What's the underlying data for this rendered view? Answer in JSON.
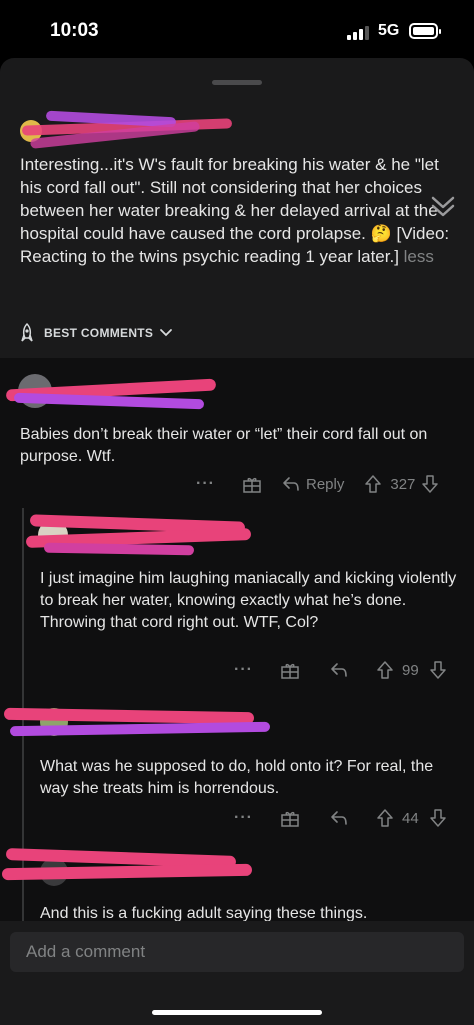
{
  "status_bar": {
    "time": "10:03",
    "network": "5G",
    "signal_bars_active": 3,
    "battery_level": 1.0
  },
  "post": {
    "body": "Interesting...it's W's fault for breaking his water & he \"let his cord fall out\". Still not considering that her choices between her water breaking & her delayed arrival at the hospital could have caused the cord prolapse. 🤔 [Video: Reacting to the twins psychic reading 1 year later.]",
    "less_label": "less",
    "sort_label": "BEST COMMENTS",
    "redaction_colors": [
      "#b24bdf",
      "#e8437a"
    ]
  },
  "comments": [
    {
      "text": "Babies don’t break their water or “let” their cord fall out on purpose. Wtf.",
      "reply_label": "Reply",
      "votes": "327",
      "more_label": "···"
    },
    {
      "text": "I just imagine him laughing maniacally and kicking violently to break her water, knowing exactly what he’s done. Throwing that cord right out. WTF, Col?",
      "votes": "99",
      "more_label": "···"
    },
    {
      "text": "What was he supposed to do, hold onto it? For real, the way she treats him is horrendous.",
      "votes": "44",
      "more_label": "···"
    },
    {
      "text": "And this is a fucking adult saying these things."
    }
  ],
  "composer": {
    "placeholder": "Add a comment"
  },
  "colors": {
    "background": "#000000",
    "sheet": "#1a1a1b",
    "comments_bg": "#0f0f10",
    "text": "#e6e6e6",
    "muted": "#818384"
  }
}
